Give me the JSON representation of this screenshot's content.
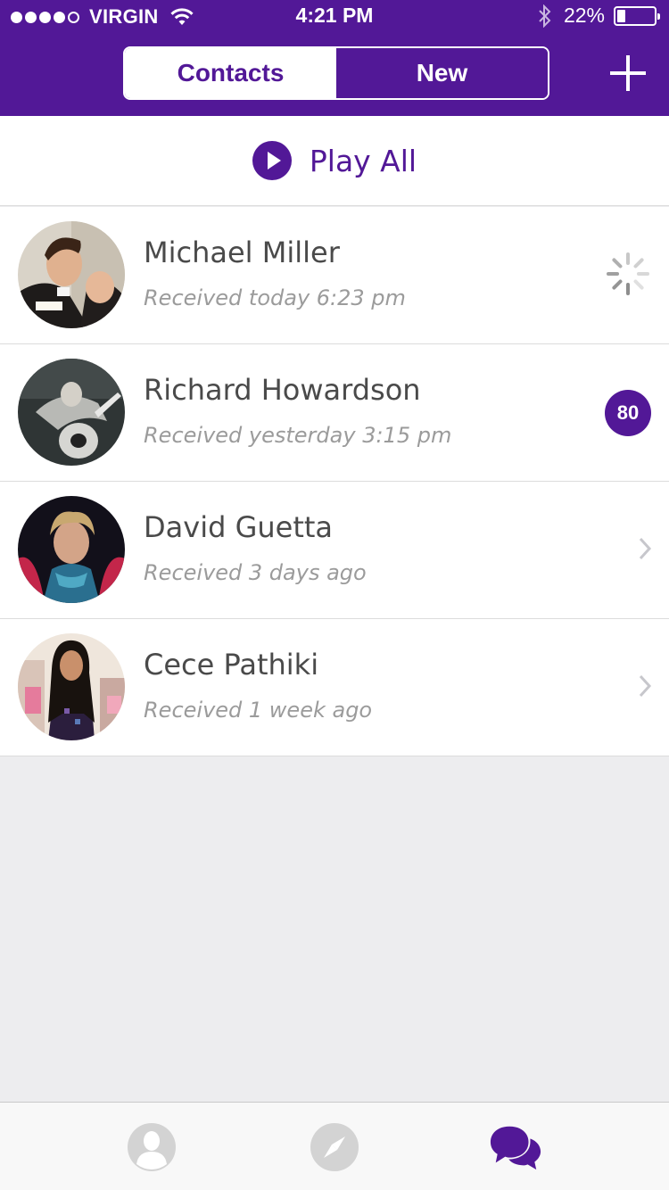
{
  "status_bar": {
    "carrier": "VIRGIN",
    "time": "4:21 PM",
    "battery_percent": "22%",
    "battery_level": 0.22,
    "signal_dots_filled": 4,
    "signal_dots_total": 5
  },
  "header": {
    "segments": [
      {
        "label": "Contacts",
        "selected": false
      },
      {
        "label": "New",
        "selected": true
      }
    ],
    "add_icon": "plus-icon"
  },
  "play_all": {
    "label": "Play All",
    "icon": "play-circle-icon"
  },
  "contacts": [
    {
      "name": "Michael Miller",
      "received": "Received today 6:23 pm",
      "status": "loading"
    },
    {
      "name": "Richard Howardson",
      "received": "Received yesterday 3:15 pm",
      "status": "badge",
      "badge": "80"
    },
    {
      "name": "David Guetta",
      "received": "Received 3 days ago",
      "status": "chevron"
    },
    {
      "name": "Cece Pathiki",
      "received": "Received 1 week ago",
      "status": "chevron"
    }
  ],
  "tabbar": {
    "tabs": [
      {
        "icon": "profile-icon",
        "active": false
      },
      {
        "icon": "compass-icon",
        "active": false
      },
      {
        "icon": "chat-bubbles-icon",
        "active": true
      }
    ]
  },
  "colors": {
    "brand_purple": "#521897",
    "background_gray": "#ededef",
    "text_dark": "#4a4a4a",
    "text_muted": "#9b9b9b"
  }
}
